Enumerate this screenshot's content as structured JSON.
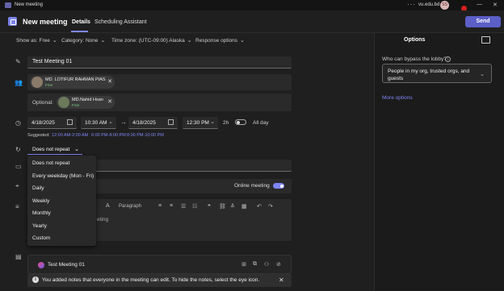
{
  "titlebar": {
    "title": "New meeting",
    "dots": "···",
    "org": "vu.edu.bd",
    "avatar_initials": "SS",
    "min": "—",
    "max": "☐",
    "close": "✕"
  },
  "header": {
    "title": "New meeting",
    "tabs": [
      "Details",
      "Scheduling Assistant"
    ],
    "send_label": "Send"
  },
  "optbar": {
    "show_as": "Show as: Free",
    "category": "Category: None",
    "timezone": "Time zone: (UTC-09:00) Alaska",
    "response": "Response options"
  },
  "meeting": {
    "title": "Test Meeting 01",
    "required_attendee": {
      "name": "MD. LOTIFUR RAHMAN PIAS",
      "status": "Free"
    },
    "optional_label": "Optional:",
    "optional_attendee": {
      "name": "MD.Nahid Hsan",
      "status": "Free"
    },
    "start_date": "4/18/2025",
    "start_time": "10:30 AM",
    "end_date": "4/18/2025",
    "end_time": "12:30 PM",
    "duration": "2h",
    "all_day": "All day",
    "suggested_label": "Suggested:",
    "suggested_times": [
      "12:00 AM-2:00 AM",
      "6:00 PM-8:00 PM",
      "8:00 PM-10:00 PM"
    ],
    "repeat": "Does not repeat",
    "online_label": "Online meeting",
    "editor_hint": "eting",
    "paragraph": "Paragraph"
  },
  "repeat_options": [
    "Does not repeat",
    "Every weekday (Mon - Fri)",
    "Daily",
    "Weekly",
    "Monthly",
    "Yearly",
    "Custom"
  ],
  "notes": {
    "title": "Test Meeting 01",
    "banner": "You added notes that everyone in the meeting can edit. To hide the notes, select the eye icon."
  },
  "options_panel": {
    "title": "Options",
    "lobby_label": "Who can bypass the lobby?",
    "lobby_value": "People in my org, trusted orgs, and guests",
    "more": "More options"
  },
  "colors": {
    "accent": "#5b5fc7",
    "link": "#7f85f5",
    "background": "#1f1f1f"
  }
}
